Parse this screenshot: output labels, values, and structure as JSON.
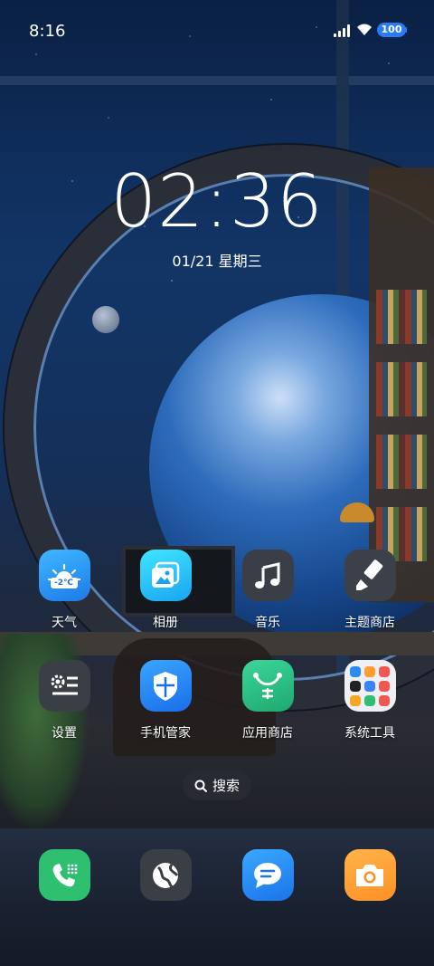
{
  "status_bar": {
    "time": "8:16",
    "battery": "100",
    "icons": [
      "signal-icon",
      "wifi-icon",
      "battery-icon"
    ]
  },
  "clock_widget": {
    "time": "02:36",
    "date": "01/21 星期三"
  },
  "apps": [
    {
      "id": "weather",
      "label": "天气",
      "icon": "weather-icon",
      "badge": "-2℃"
    },
    {
      "id": "gallery",
      "label": "相册",
      "icon": "gallery-icon"
    },
    {
      "id": "music",
      "label": "音乐",
      "icon": "music-icon"
    },
    {
      "id": "themes",
      "label": "主题商店",
      "icon": "theme-store-icon"
    },
    {
      "id": "settings",
      "label": "设置",
      "icon": "settings-icon"
    },
    {
      "id": "security",
      "label": "手机管家",
      "icon": "security-icon"
    },
    {
      "id": "appstore",
      "label": "应用商店",
      "icon": "app-store-icon"
    },
    {
      "id": "tools",
      "label": "系统工具",
      "icon": "folder-icon"
    }
  ],
  "search": {
    "label": "搜索",
    "icon": "search-icon"
  },
  "dock": [
    {
      "id": "phone",
      "icon": "phone-icon"
    },
    {
      "id": "browser",
      "icon": "browser-icon"
    },
    {
      "id": "messages",
      "icon": "messages-icon"
    },
    {
      "id": "camera",
      "icon": "camera-icon"
    }
  ],
  "colors": {
    "battery": "#2a7cf4",
    "weather": "#1d7ae8",
    "gallery": "#1aa4f0",
    "app_store": "#1fa86e",
    "phone": "#2fbf71",
    "camera": "#ff9026"
  }
}
